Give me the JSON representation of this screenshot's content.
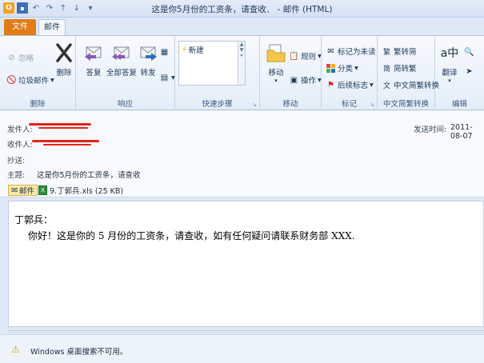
{
  "window": {
    "title": "这是你5月份的工资条，请查收． - 邮件 (HTML)"
  },
  "tabs": {
    "file": "文件",
    "mail": "邮件"
  },
  "ribbon": {
    "delete_group": {
      "ignore": "忽略",
      "junk": "垃圾邮件",
      "delete": "删除",
      "label": "删除"
    },
    "respond_group": {
      "reply": "答复",
      "reply_all": "全部答复",
      "forward": "转发",
      "label": "响应"
    },
    "quicksteps_group": {
      "item": "新建",
      "label": "快速步骤"
    },
    "move_group": {
      "move": "移动",
      "rules": "规则",
      "actions": "操作",
      "label": "移动"
    },
    "tags_group": {
      "mark_unread": "标记为未读",
      "categorize": "分类",
      "follow_up": "后续标志",
      "label": "标记"
    },
    "chinese_group": {
      "to_traditional": "繁转简",
      "to_simplified": "简转繁",
      "convert": "中文简繁转换",
      "label": "中文简繁转换"
    },
    "edit_group": {
      "translate": "翻译",
      "label": "编辑"
    }
  },
  "header": {
    "from_label": "发件人:",
    "to_label": "收件人:",
    "cc_label": "抄送:",
    "subject_label": "主题:",
    "subject": "这是你5月份的工资条，请查收",
    "sent_label": "发送时间:",
    "sent_value": "2011-08-07"
  },
  "attachments": {
    "message_tab": "邮件",
    "file": "9.丁郭兵.xls (25 KB)"
  },
  "message": {
    "greeting": "丁郭兵：",
    "body": "你好！这是你的 5 月份的工资条，请查收，如有任何疑问请联系财务部 XXX."
  },
  "status": {
    "text": "Windows 桌面搜索不可用。"
  }
}
